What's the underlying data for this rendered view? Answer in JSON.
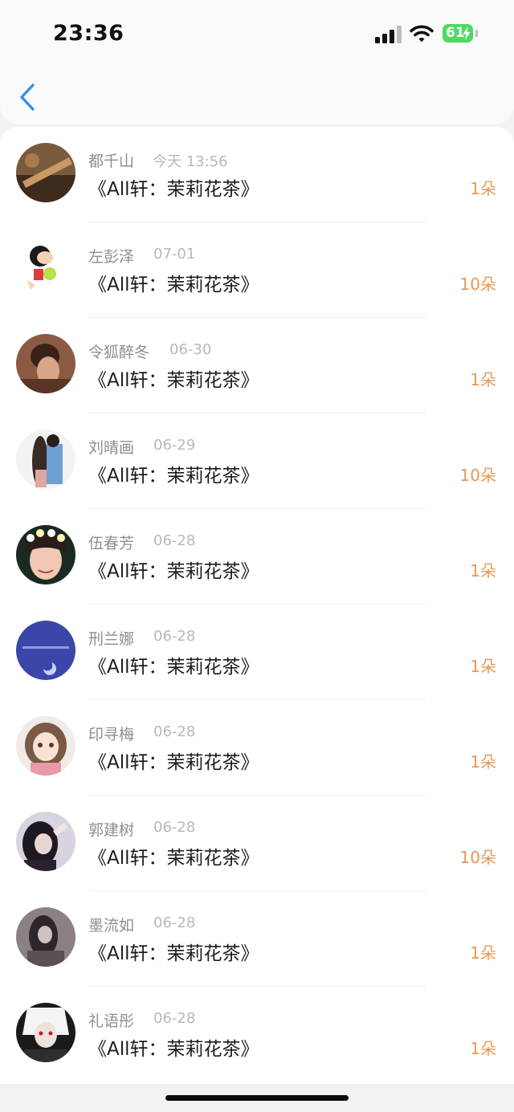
{
  "status_bar": {
    "time": "23:36",
    "battery": "61"
  },
  "icons": {
    "back": "chevron-left-icon",
    "signal": "signal-icon",
    "wifi": "wifi-icon",
    "battery": "battery-charging-icon"
  },
  "colors": {
    "accent_blue": "#3a8ee6",
    "count_orange": "#e59a55",
    "battery_green": "#4cd964"
  },
  "gifts": [
    {
      "name": "都千山",
      "date": "今天 13:56",
      "title": "《All轩：茉莉花茶》",
      "count": "1朵"
    },
    {
      "name": "左彭泽",
      "date": "07-01",
      "title": "《All轩：茉莉花茶》",
      "count": "10朵"
    },
    {
      "name": "令狐醉冬",
      "date": "06-30",
      "title": "《All轩：茉莉花茶》",
      "count": "1朵"
    },
    {
      "name": "刘晴画",
      "date": "06-29",
      "title": "《All轩：茉莉花茶》",
      "count": "10朵"
    },
    {
      "name": "伍春芳",
      "date": "06-28",
      "title": "《All轩：茉莉花茶》",
      "count": "1朵"
    },
    {
      "name": "刑兰娜",
      "date": "06-28",
      "title": "《All轩：茉莉花茶》",
      "count": "1朵"
    },
    {
      "name": "印寻梅",
      "date": "06-28",
      "title": "《All轩：茉莉花茶》",
      "count": "1朵"
    },
    {
      "name": "郭建树",
      "date": "06-28",
      "title": "《All轩：茉莉花茶》",
      "count": "10朵"
    },
    {
      "name": "墨流如",
      "date": "06-28",
      "title": "《All轩：茉莉花茶》",
      "count": "1朵"
    },
    {
      "name": "礼语彤",
      "date": "06-28",
      "title": "《All轩：茉莉花茶》",
      "count": "1朵"
    }
  ]
}
